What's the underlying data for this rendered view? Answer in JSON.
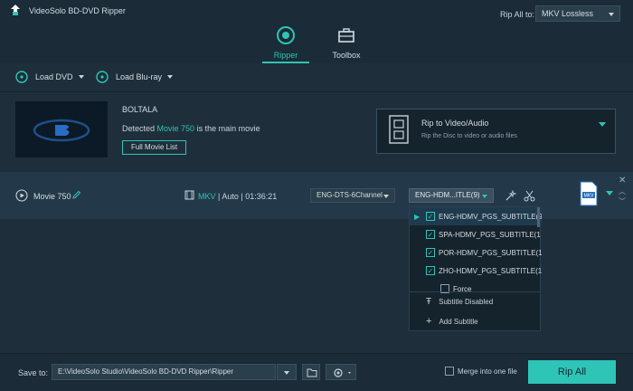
{
  "app": {
    "title": "VideoSolo BD-DVD Ripper"
  },
  "nav": {
    "tabs": [
      {
        "label": "Ripper"
      },
      {
        "label": "Toolbox"
      }
    ]
  },
  "toolbar": {
    "load_dvd": "Load DVD",
    "load_bluray": "Load Blu-ray",
    "rip_all_to_label": "Rip All to:",
    "rip_all_format": "MKV Lossless"
  },
  "disc": {
    "name": "BOLTALA",
    "detect_prefix": "Detected ",
    "detect_movie": "Movie 750",
    "detect_suffix": " is the main movie",
    "full_movie_button": "Full Movie List",
    "rip_to_title": "Rip to Video/Audio",
    "rip_to_subtitle": "Rip the Disc to video or audio files"
  },
  "movie": {
    "title": "Movie 750",
    "format": "MKV",
    "mode": "Auto",
    "duration": "01:36:21",
    "audio_track": "ENG-DTS-6Channel",
    "subtitle_track": "ENG-HDM...ITLE(9)",
    "output_badge": "MKV"
  },
  "subtitle_menu": {
    "items": [
      {
        "label": "ENG-HDMV_PGS_SUBTITLE(9",
        "checked": true
      },
      {
        "label": "SPA-HDMV_PGS_SUBTITLE(1",
        "checked": true
      },
      {
        "label": "POR-HDMV_PGS_SUBTITLE(1",
        "checked": true
      },
      {
        "label": "ZHO-HDMV_PGS_SUBTITLE(1",
        "checked": true
      }
    ],
    "force_label": "Force",
    "disabled_label": "Subtitle Disabled",
    "add_label": "Add Subtitle"
  },
  "bottom": {
    "save_to_label": "Save to:",
    "save_path": "E:\\VideoSolo Studio\\VideoSolo BD-DVD Ripper\\Ripper",
    "merge_label": "Merge into one file",
    "rip_all_button": "Rip All"
  },
  "colors": {
    "accent": "#2ec4b6",
    "background": "#1e2f3b",
    "row": "#23394a"
  }
}
